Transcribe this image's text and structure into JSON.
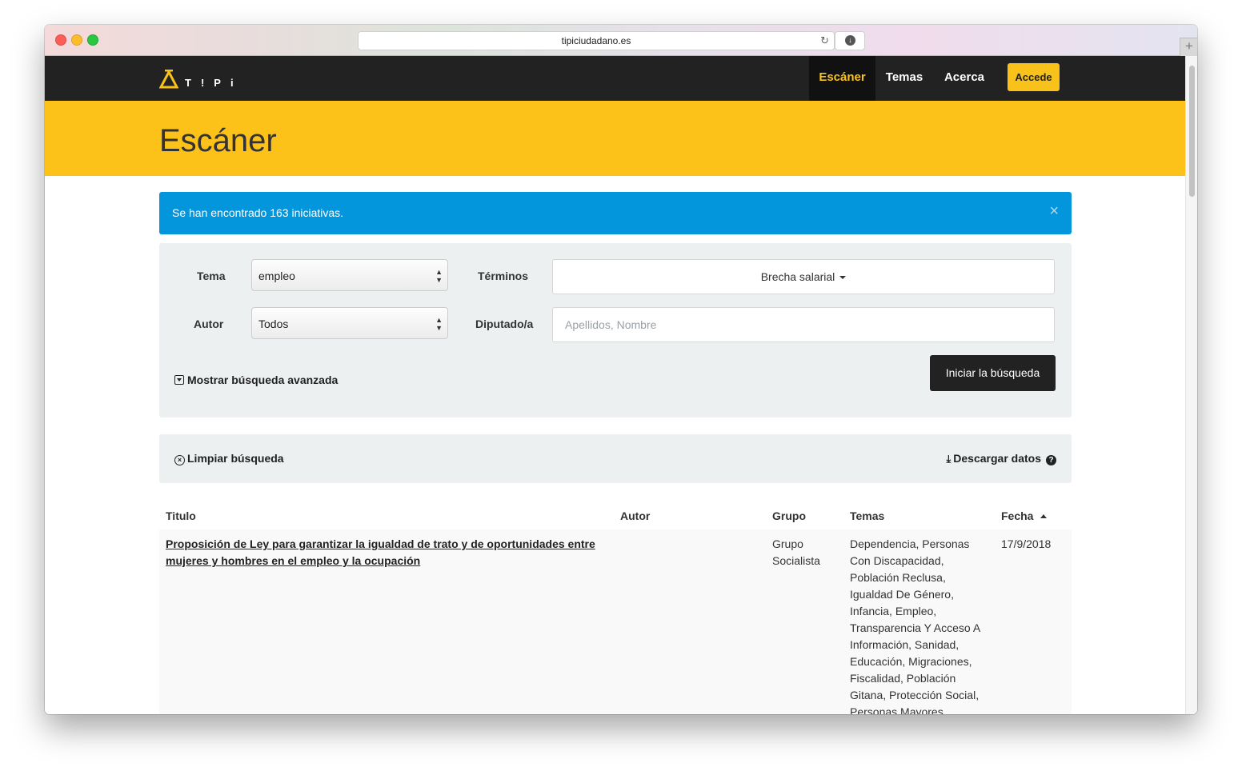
{
  "browser": {
    "url": "tipiciudadano.es"
  },
  "site": {
    "logo_text": "T!Pi",
    "nav": {
      "items": [
        {
          "label": "Escáner",
          "active": true
        },
        {
          "label": "Temas",
          "active": false
        },
        {
          "label": "Acerca",
          "active": false
        }
      ],
      "login_label": "Accede"
    }
  },
  "page": {
    "title": "Escáner"
  },
  "alert": {
    "message": "Se han encontrado 163 iniciativas.",
    "close_symbol": "×"
  },
  "search": {
    "tema_label": "Tema",
    "tema_value": "empleo",
    "terminos_label": "Términos",
    "terminos_value": "Brecha salarial",
    "autor_label": "Autor",
    "autor_value": "Todos",
    "diputado_label": "Diputado/a",
    "diputado_placeholder": "Apellidos, Nombre",
    "advanced_label": "Mostrar búsqueda avanzada",
    "submit_label": "Iniciar la búsqueda"
  },
  "actions": {
    "clear_label": "Limpiar búsqueda",
    "download_label": "Descargar datos"
  },
  "table": {
    "headers": {
      "titulo": "Titulo",
      "autor": "Autor",
      "grupo": "Grupo",
      "temas": "Temas",
      "fecha": "Fecha"
    },
    "sort_column": "Fecha",
    "rows": [
      {
        "titulo": "Proposición de Ley para garantizar la igualdad de trato y de oportunidades entre mujeres y hombres en el empleo y la ocupación",
        "autor": "",
        "grupo": "Grupo Socialista",
        "temas": "Dependencia, Personas Con Discapacidad, Población Reclusa, Igualdad De Género, Infancia, Empleo, Transparencia Y Acceso A Información, Sanidad, Educación, Migraciones, Fiscalidad, Población Gitana, Protección Social, Personas Mayores",
        "fecha": "17/9/2018"
      }
    ]
  },
  "colors": {
    "brand_yellow": "#fdc21a",
    "navbar": "#222222",
    "alert_blue": "#0496dd",
    "panel_gray": "#ecf0f1"
  }
}
